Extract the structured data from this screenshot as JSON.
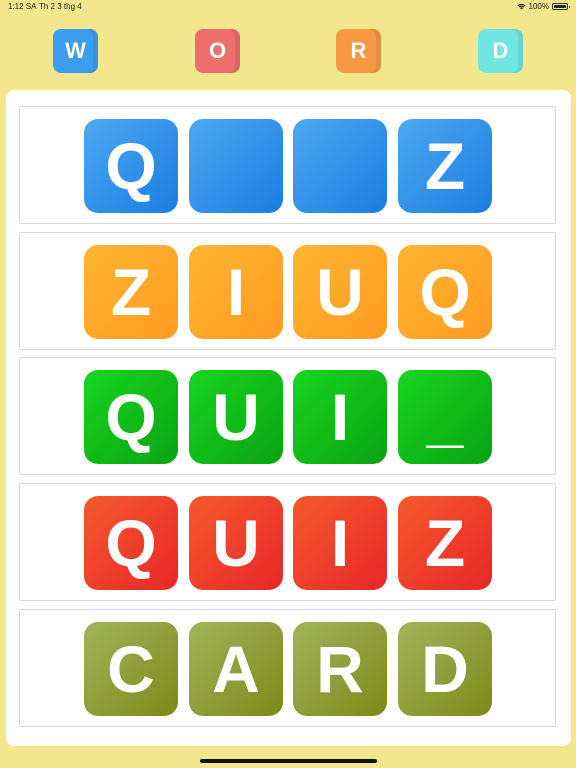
{
  "status_bar": {
    "time": "1:12 SA",
    "date": "Th 2 3 thg 4",
    "battery": "100%"
  },
  "header_tiles": [
    {
      "letter": "W",
      "color": "#3d9ef0"
    },
    {
      "letter": "O",
      "color": "#ee6d6d"
    },
    {
      "letter": "R",
      "color": "#f59a42"
    },
    {
      "letter": "D",
      "color": "#6fe6e2"
    }
  ],
  "rows": [
    {
      "name": "blue",
      "gradient": [
        "#4ea8f2",
        "#1a7de0"
      ],
      "tiles": [
        "Q",
        "",
        "",
        "Z"
      ]
    },
    {
      "name": "orange",
      "gradient": [
        "#ffb632",
        "#ff9a22"
      ],
      "tiles": [
        "Z",
        "I",
        "U",
        "Q"
      ]
    },
    {
      "name": "green",
      "gradient": [
        "#18d51f",
        "#0aa313"
      ],
      "tiles": [
        "Q",
        "U",
        "I",
        "_"
      ]
    },
    {
      "name": "red",
      "gradient": [
        "#f55a2c",
        "#e8262a"
      ],
      "tiles": [
        "Q",
        "U",
        "I",
        "Z"
      ]
    },
    {
      "name": "olive",
      "gradient": [
        "#a3b35c",
        "#7c8a18"
      ],
      "tiles": [
        "C",
        "A",
        "R",
        "D"
      ]
    }
  ]
}
